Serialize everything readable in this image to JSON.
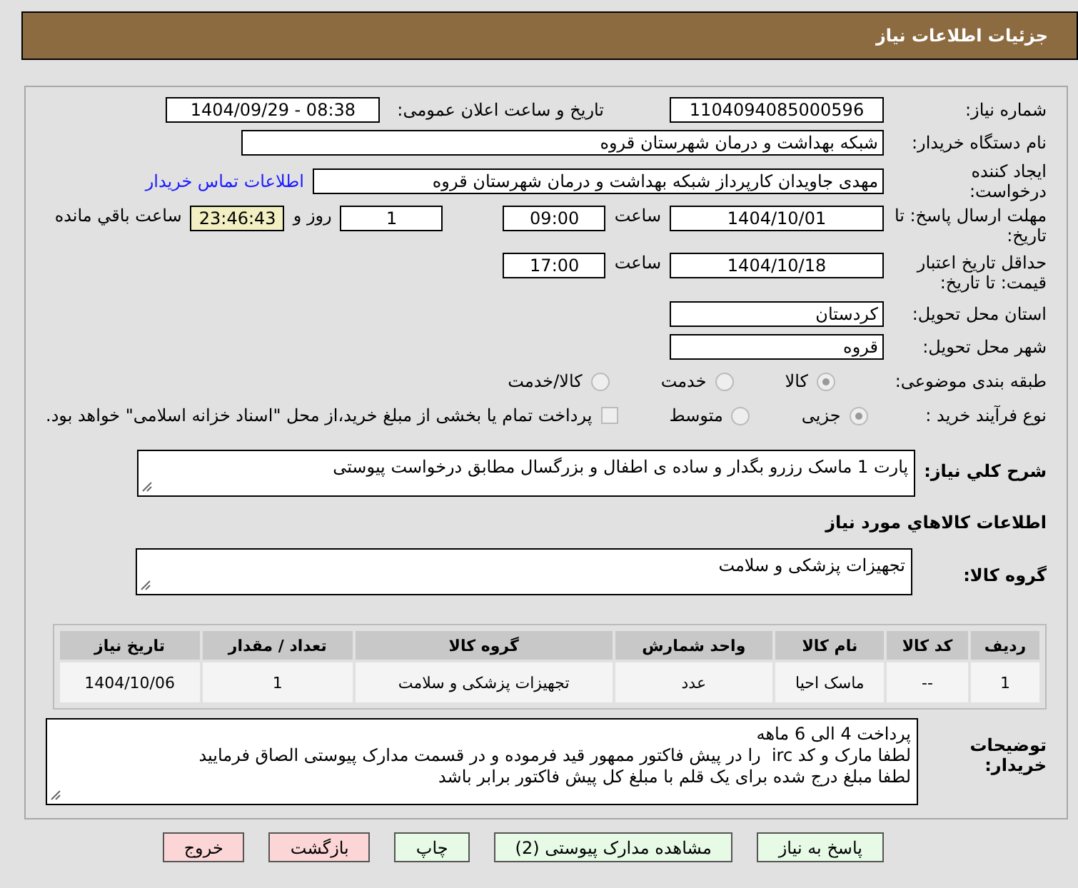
{
  "header": {
    "title": "جزئیات اطلاعات نیاز"
  },
  "fields": {
    "need_number": {
      "label": "شماره نیاز:",
      "value": "1104094085000596"
    },
    "announce": {
      "label": "تاریخ و ساعت اعلان عمومی:",
      "value": "1404/09/29 - 08:38"
    },
    "buyer": {
      "label": "نام دستگاه خریدار:",
      "value": "شبکه بهداشت و درمان شهرستان قروه"
    },
    "creator": {
      "label": "ایجاد کننده درخواست:",
      "value": "مهدی جاویدان کارپرداز شبکه بهداشت و درمان شهرستان قروه",
      "link": "اطلاعات تماس خریدار"
    },
    "deadline": {
      "label": "مهلت ارسال پاسخ: تا تاریخ:",
      "date": "1404/10/01",
      "time_label": "ساعت",
      "time": "09:00",
      "days": "1",
      "days_label": "روز و",
      "remaining": "23:46:43",
      "remaining_label": "ساعت باقي مانده"
    },
    "validity": {
      "label": "حداقل تاریخ اعتبار قیمت: تا تاریخ:",
      "date": "1404/10/18",
      "time_label": "ساعت",
      "time": "17:00"
    },
    "province": {
      "label": "استان محل تحویل:",
      "value": "کردستان"
    },
    "city": {
      "label": "شهر محل تحویل:",
      "value": "قروه"
    }
  },
  "category": {
    "label": "طبقه بندی موضوعی:",
    "options": [
      {
        "label": "کالا",
        "selected": true
      },
      {
        "label": "خدمت",
        "selected": false
      },
      {
        "label": "کالا/خدمت",
        "selected": false
      }
    ]
  },
  "process": {
    "label": "نوع فرآیند خرید :",
    "options": [
      {
        "label": "جزیی",
        "selected": true
      },
      {
        "label": "متوسط",
        "selected": false
      }
    ],
    "payment": {
      "label": "پرداخت تمام یا بخشی از مبلغ خرید،از محل \"اسناد خزانه اسلامی\" خواهد بود.",
      "checked": false
    }
  },
  "description": {
    "label": "شرح کلي نیاز:",
    "value": "پارت 1 ماسک رزرو بگدار و ساده ی اطفال و بزرگسال مطابق درخواست پیوستی"
  },
  "goods_heading": "اطلاعات کالاهاي مورد نیاز",
  "goods_group": {
    "label": "گروه کالا:",
    "value": "تجهیزات پزشکی و سلامت"
  },
  "table": {
    "columns": [
      "ردیف",
      "کد کالا",
      "نام کالا",
      "واحد شمارش",
      "گروه کالا",
      "تعداد / مقدار",
      "تاریخ نیاز"
    ],
    "rows": [
      [
        "1",
        "--",
        "ماسک احیا",
        "عدد",
        "تجهیزات پزشکی و سلامت",
        "1",
        "1404/10/06"
      ]
    ]
  },
  "notes": {
    "label": "توضیحات خریدار:",
    "lines": [
      "پرداخت 4 الی 6 ماهه",
      "لطفا مارک و کد irc  را در پیش فاکتور ممهور قید فرموده و در قسمت مدارک پیوستی الصاق فرمایید",
      "لطفا مبلغ درج شده برای یک قلم با مبلغ کل پیش فاکتور برابر باشد"
    ]
  },
  "buttons": [
    {
      "label": "پاسخ به نیاز",
      "kind": "normal"
    },
    {
      "label": "مشاهده مدارک پیوستی (2)",
      "kind": "normal"
    },
    {
      "label": "چاپ",
      "kind": "normal"
    },
    {
      "label": "بازگشت",
      "kind": "danger"
    },
    {
      "label": "خروج",
      "kind": "danger"
    }
  ]
}
